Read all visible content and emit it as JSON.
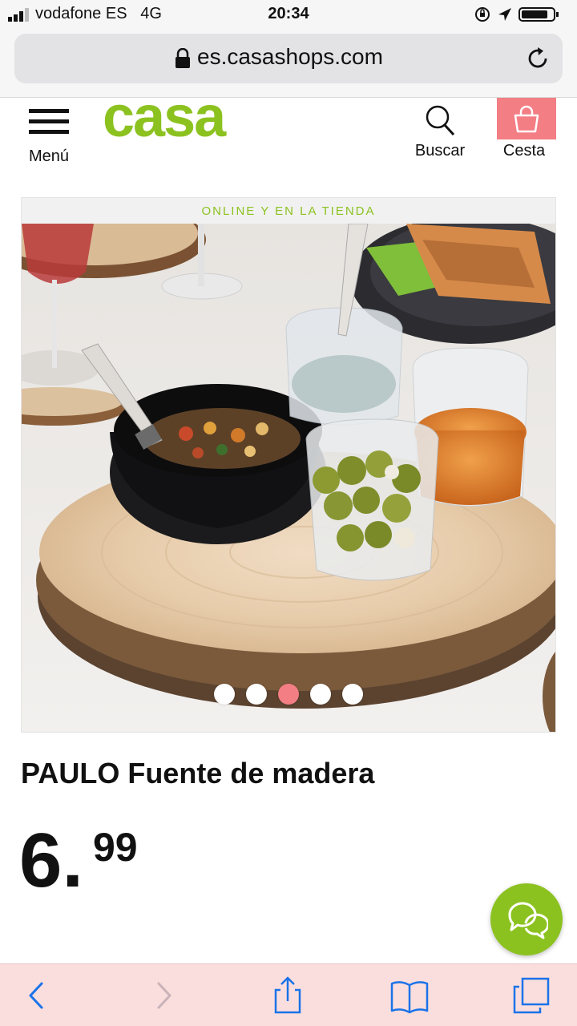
{
  "status_bar": {
    "carrier": "vodafone ES",
    "network": "4G",
    "time": "20:34",
    "signal_bars": 3,
    "icons": [
      "signal-icon",
      "orientation-lock-icon",
      "location-arrow-icon",
      "battery-icon"
    ]
  },
  "browser": {
    "url": "es.casashops.com",
    "icons": [
      "lock-icon",
      "reload-icon"
    ]
  },
  "header": {
    "logo": "casa",
    "menu_label": "Menú",
    "search_label": "Buscar",
    "cart_label": "Cesta",
    "icons": [
      "hamburger-icon",
      "search-icon",
      "shopping-bag-icon"
    ]
  },
  "product": {
    "banner": "ONLINE Y EN LA TIENDA",
    "title": "PAULO Fuente de madera",
    "price_int": "6.",
    "price_dec": "99",
    "carousel": {
      "total": 5,
      "active": 3
    }
  },
  "chat": {
    "icon": "chat-bubbles-icon"
  },
  "toolbar": {
    "icons": [
      "back-icon",
      "forward-icon",
      "share-icon",
      "bookmarks-icon",
      "tabs-icon"
    ]
  },
  "colors": {
    "brand_green": "#8cc220",
    "cart_pink": "#f37e84",
    "toolbar_pink": "#fadede",
    "ios_blue": "#1a73e8"
  }
}
